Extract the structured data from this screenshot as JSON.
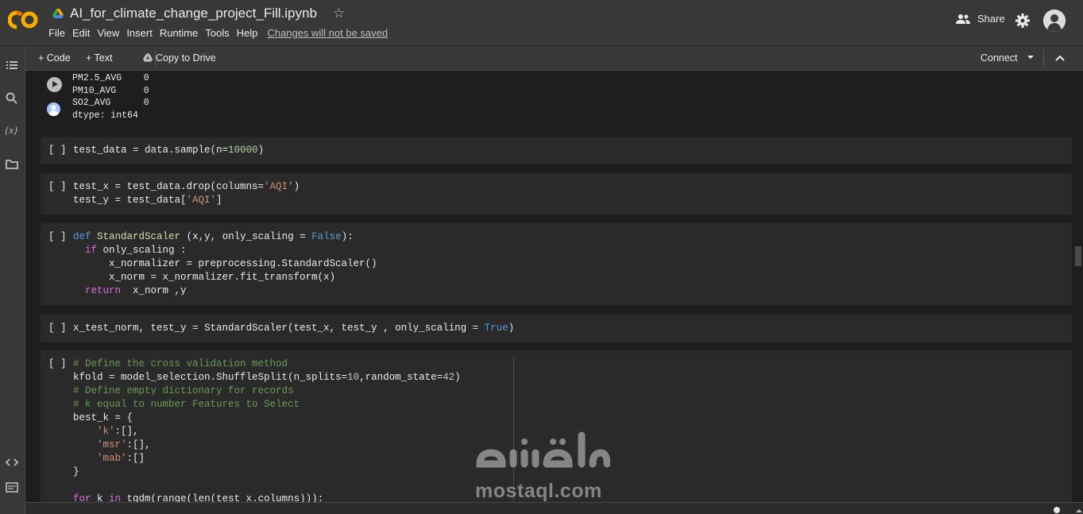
{
  "header": {
    "title": "AI_for_climate_change_project_Fill.ipynb",
    "menu": [
      "File",
      "Edit",
      "View",
      "Insert",
      "Runtime",
      "Tools",
      "Help"
    ],
    "unsaved_notice": "Changes will not be saved",
    "share_label": "Share",
    "logo_name": "colab-logo"
  },
  "toolbar": {
    "code_label": "+ Code",
    "text_label": "+ Text",
    "copy_label": "Copy to Drive",
    "connect_label": "Connect"
  },
  "sidebar": {
    "icons": [
      "table-of-contents-icon",
      "search-icon",
      "variables-icon",
      "folder-icon",
      "code-snippets-icon",
      "terminal-icon"
    ],
    "variables_label": "{x}"
  },
  "output": {
    "lines": [
      "PM2.5_AVG    0",
      "PM10_AVG     0",
      "SO2_AVG      0",
      "dtype: int64"
    ]
  },
  "cells": [
    {
      "bracket": "[ ]",
      "code": "test_data = data.sample(n=10000)"
    },
    {
      "bracket": "[ ]",
      "code": "test_x = test_data.drop(columns='AQI')\ntest_y = test_data['AQI']"
    },
    {
      "bracket": "[ ]",
      "code": "def StandardScaler (x,y, only_scaling = False):\n  if only_scaling :\n      x_normalizer = preprocessing.StandardScaler()\n      x_norm = x_normalizer.fit_transform(x)\n  return  x_norm ,y"
    },
    {
      "bracket": "[ ]",
      "code": "x_test_norm, test_y = StandardScaler(test_x, test_y , only_scaling = True)"
    },
    {
      "bracket": "[ ]",
      "code": "# Define the cross validation method\nkfold = model_selection.ShuffleSplit(n_splits=10,random_state=42)\n# Define empty dictionary for records\n# k equal to number Features to Select\nbest_k = {\n    'k':[],\n    'msr':[],\n    'mab':[]\n}\n\nfor k in tqdm(range(len(test_x.columns))):"
    }
  ],
  "watermark": {
    "arabic": "مستقل",
    "latin": "mostaql.com"
  },
  "colors": {
    "background": "#1e1e1e",
    "header": "#383838",
    "cell": "#2a2a2a",
    "logo_orange": "#f9ab00",
    "keyword": "#4fc1ff",
    "string": "#ce9178",
    "comment": "#6a9955"
  }
}
